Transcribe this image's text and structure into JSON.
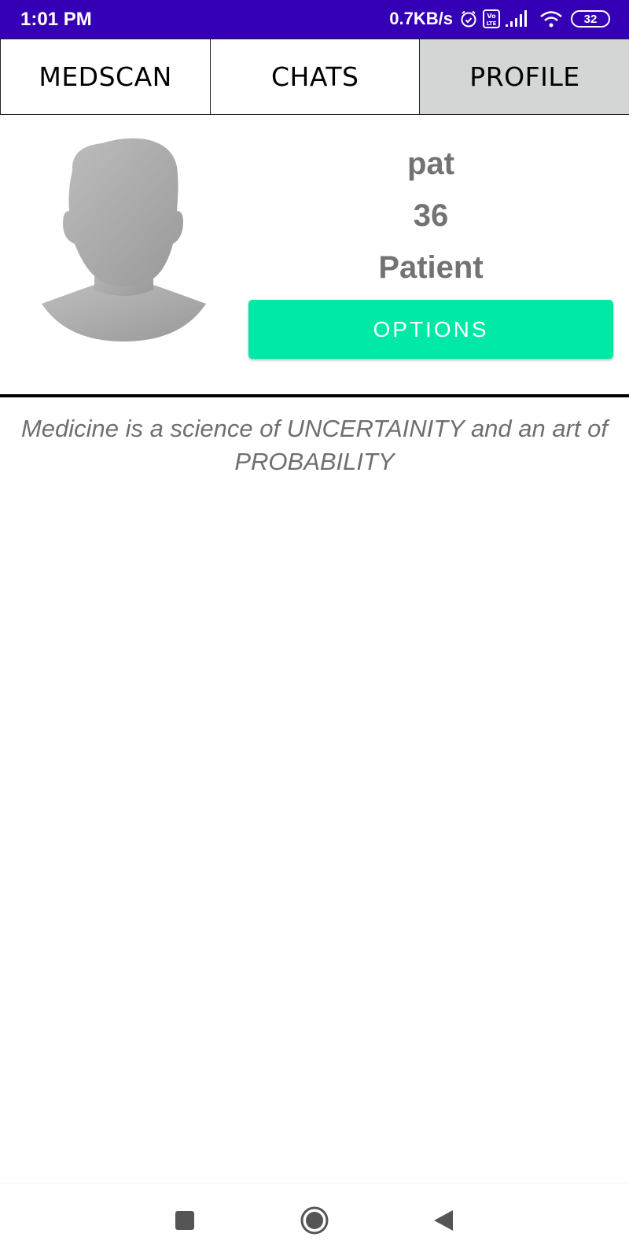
{
  "status_bar": {
    "time": "1:01 PM",
    "network_speed": "0.7KB/s",
    "battery_level": "32",
    "icons": [
      "alarm-icon",
      "volte-icon",
      "signal-icon",
      "wifi-icon",
      "battery-icon"
    ],
    "background_color": "#3500b5"
  },
  "tabs": [
    {
      "label": "MEDSCAN",
      "active": false
    },
    {
      "label": "CHATS",
      "active": false
    },
    {
      "label": "PROFILE",
      "active": true
    }
  ],
  "profile": {
    "avatar_icon": "person-silhouette-icon",
    "name": "pat",
    "age": "36",
    "role": "Patient",
    "options_label": "OPTIONS",
    "options_color": "#00e8a6"
  },
  "quote": {
    "text": "Medicine is a science of UNCERTAINITY and an art of PROBABILITY"
  },
  "nav_bar": {
    "icons": [
      "recents-icon",
      "home-icon",
      "back-icon"
    ]
  }
}
